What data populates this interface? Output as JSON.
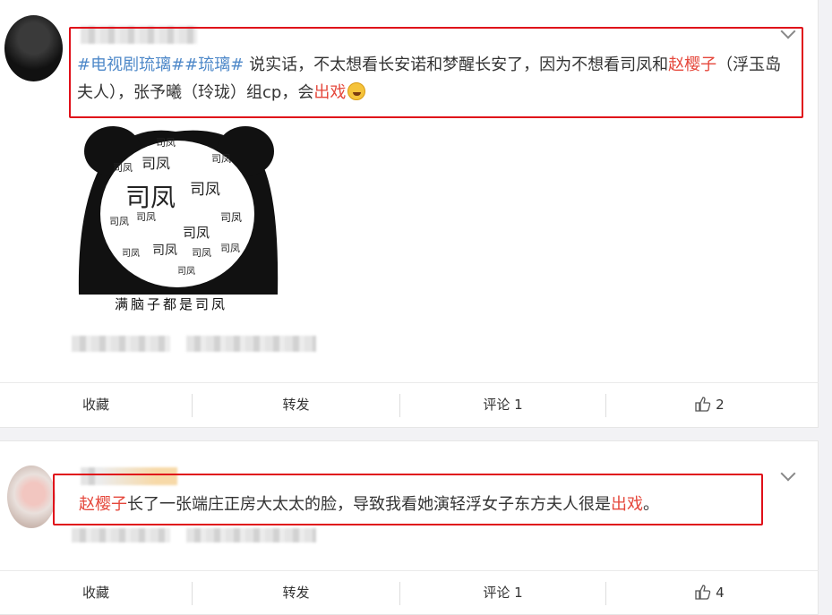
{
  "posts": [
    {
      "text": {
        "tag1": "#电视剧琉璃#",
        "tag2": "#琉璃#",
        "part1": " 说实话，不太想看长安诺和梦醒长安了，因为不想看司凤和",
        "name": "赵樱子",
        "part2": "（浮玉岛夫人），张予曦（玲珑）组cp，会",
        "highlight": "出戏"
      },
      "meme": {
        "word": "司凤",
        "caption": "满脑子都是司凤"
      },
      "actions": {
        "favorite": "收藏",
        "repost": "转发",
        "comment": "评论 1",
        "like_count": "2"
      }
    },
    {
      "text": {
        "name": "赵樱子",
        "part1": "长了一张端庄正房大太太的脸，导致我看她演轻浮女子东方夫人很是",
        "highlight": "出戏",
        "end": "。"
      },
      "actions": {
        "favorite": "收藏",
        "repost": "转发",
        "comment": "评论 1",
        "like_count": "4"
      }
    }
  ],
  "colors": {
    "tag": "#4f89c9",
    "highlight": "#e5473b",
    "annotation": "#e0101a"
  },
  "icons": [
    "chevron-down-icon",
    "thumbs-up-icon",
    "laugh-cry-emoji-icon"
  ]
}
